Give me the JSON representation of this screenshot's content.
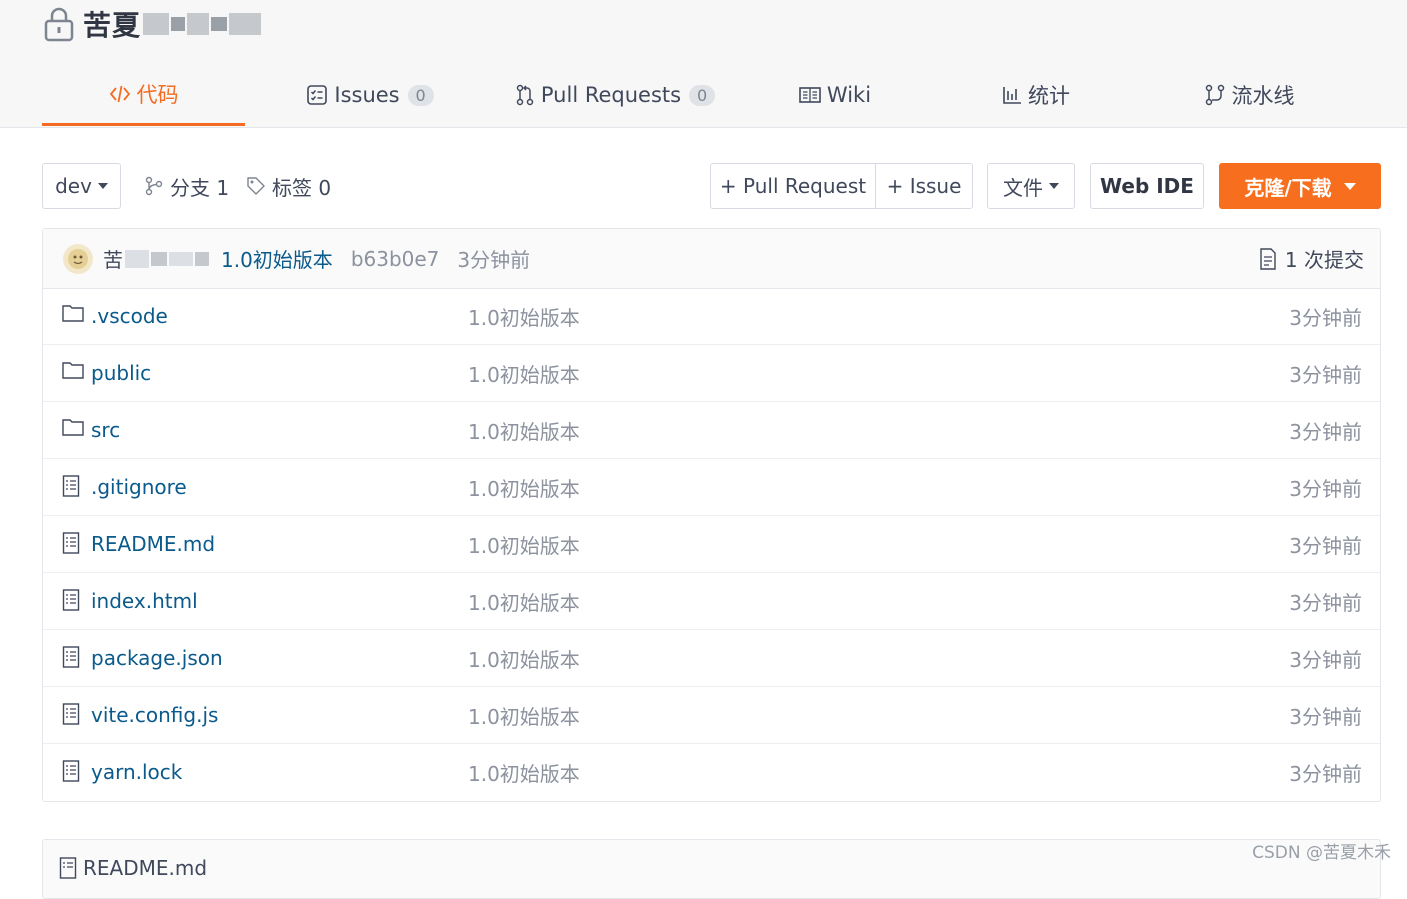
{
  "repo": {
    "name": "苦夏"
  },
  "tabs": [
    {
      "label": "代码",
      "icon": "code-icon",
      "active": true
    },
    {
      "label": "Issues",
      "icon": "issues-icon",
      "count": "0"
    },
    {
      "label": "Pull Requests",
      "icon": "pull-request-icon",
      "count": "0"
    },
    {
      "label": "Wiki",
      "icon": "book-icon"
    },
    {
      "label": "统计",
      "icon": "bar-chart-icon"
    },
    {
      "label": "流水线",
      "icon": "pipeline-icon"
    }
  ],
  "toolbar": {
    "branch": "dev",
    "branches_label": "分支 1",
    "tags_label": "标签 0",
    "pull_request_button": "+ Pull Request",
    "issue_button": "+ Issue",
    "file_button": "文件",
    "web_ide_button": "Web IDE",
    "clone_button": "克隆/下载"
  },
  "commit": {
    "user": "苦",
    "message": "1.0初始版本",
    "hash": "b63b0e7",
    "time": "3分钟前",
    "count_label": "1 次提交"
  },
  "files": [
    {
      "name": ".vscode",
      "type": "folder",
      "commit": "1.0初始版本",
      "time": "3分钟前"
    },
    {
      "name": "public",
      "type": "folder",
      "commit": "1.0初始版本",
      "time": "3分钟前"
    },
    {
      "name": "src",
      "type": "folder",
      "commit": "1.0初始版本",
      "time": "3分钟前"
    },
    {
      "name": ".gitignore",
      "type": "file",
      "commit": "1.0初始版本",
      "time": "3分钟前"
    },
    {
      "name": "README.md",
      "type": "file",
      "commit": "1.0初始版本",
      "time": "3分钟前"
    },
    {
      "name": "index.html",
      "type": "file",
      "commit": "1.0初始版本",
      "time": "3分钟前"
    },
    {
      "name": "package.json",
      "type": "file",
      "commit": "1.0初始版本",
      "time": "3分钟前"
    },
    {
      "name": "vite.config.js",
      "type": "file",
      "commit": "1.0初始版本",
      "time": "3分钟前"
    },
    {
      "name": "yarn.lock",
      "type": "file",
      "commit": "1.0初始版本",
      "time": "3分钟前"
    }
  ],
  "readme": {
    "title": "README.md"
  },
  "watermark": "CSDN @苦夏木禾",
  "colors": {
    "accent": "#f36c21",
    "link": "#0b5a8c",
    "muted": "#8c929e"
  }
}
